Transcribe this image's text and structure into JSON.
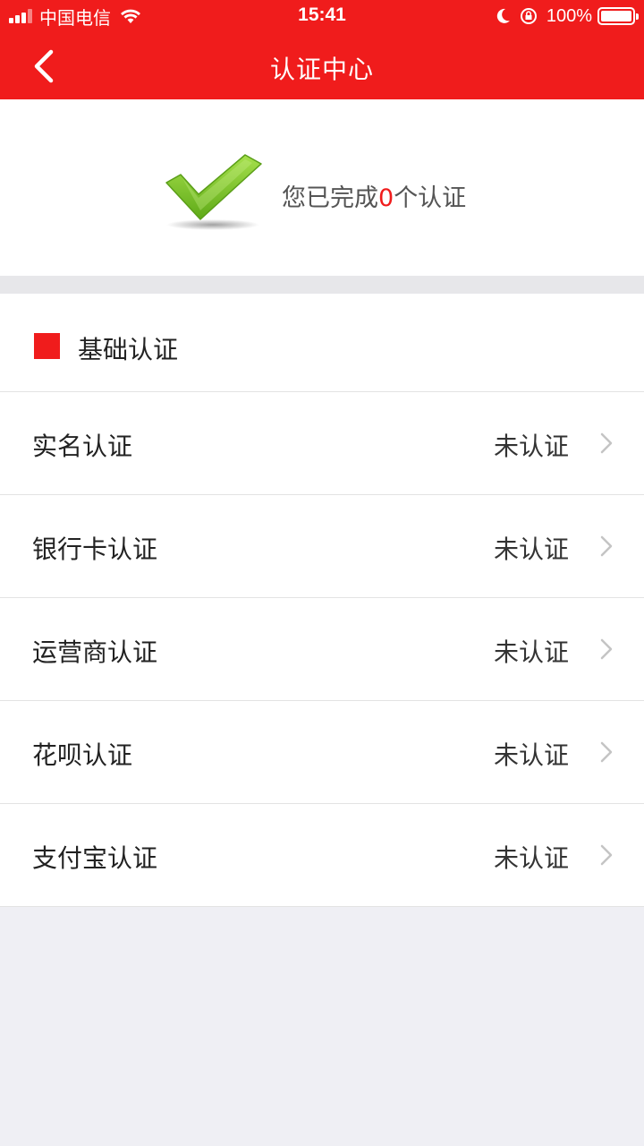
{
  "status_bar": {
    "carrier": "中国电信",
    "time": "15:41",
    "battery": "100%"
  },
  "nav": {
    "title": "认证中心"
  },
  "summary": {
    "prefix": "您已完成",
    "count": "0",
    "suffix": "个认证"
  },
  "section": {
    "title": "基础认证",
    "items": [
      {
        "label": "实名认证",
        "status": "未认证"
      },
      {
        "label": "银行卡认证",
        "status": "未认证"
      },
      {
        "label": "运营商认证",
        "status": "未认证"
      },
      {
        "label": "花呗认证",
        "status": "未认证"
      },
      {
        "label": "支付宝认证",
        "status": "未认证"
      }
    ]
  },
  "colors": {
    "brand_red": "#f01c1c",
    "check_green": "#7cc22a"
  },
  "icons": [
    "signal-icon",
    "wifi-icon",
    "moon-icon",
    "rotation-lock-icon",
    "battery-icon",
    "back-arrow-icon",
    "checkmark-icon",
    "chevron-right-icon"
  ]
}
